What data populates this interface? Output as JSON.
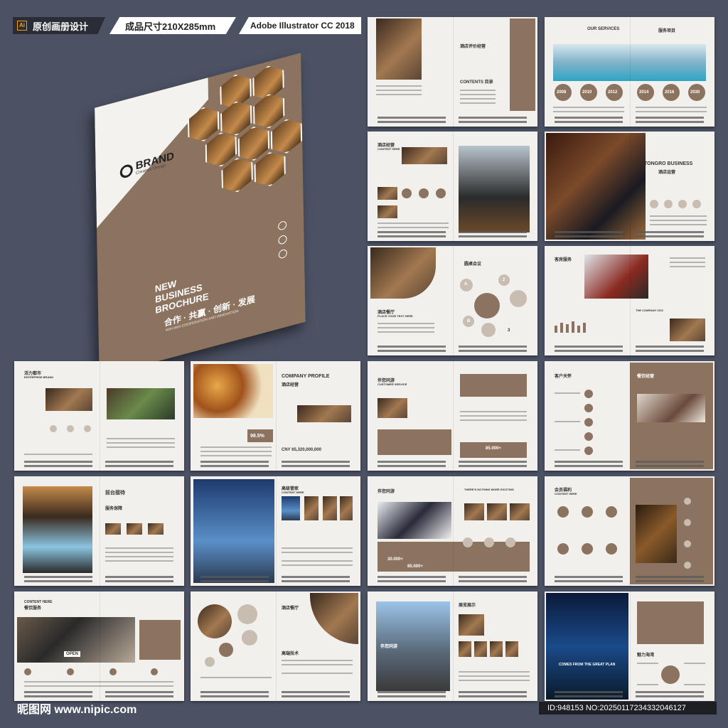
{
  "header": {
    "tag1": "原创画册设计",
    "tag2": "成品尺寸210X285mm",
    "tag3": "Adobe Illustrator CC 2018",
    "ai_icon": "Ai"
  },
  "cover": {
    "brand": "BRAND",
    "brand_sub": "Creative Design",
    "title_line1": "NEW",
    "title_line2": "BUSINESS",
    "title_line3": "BROCHURE",
    "slogan": "合作 · 共赢 · 创新 · 发展",
    "slogan_sub": "WIN-WIN COOPERATION AND INNOVATION"
  },
  "spreads": [
    {
      "t1": "酒店评价经营",
      "t2": "CONTENTS 目录"
    },
    {
      "t1": "OUR SERVICES",
      "t2": "服务项目",
      "years": [
        "2008",
        "2010",
        "2012",
        "2014",
        "2016",
        "2030"
      ]
    },
    {
      "t1": "酒店经营",
      "t2": "CONTENT HERE"
    },
    {
      "t1": "TONGRO BUSINESS",
      "t2": "酒店运营"
    },
    {
      "t1": "酒店餐厅",
      "t2": "圆桌会议",
      "t3": "PLACE YOUR TEXT HERE",
      "nodes": [
        "A",
        "2",
        "B",
        "3"
      ]
    },
    {
      "t1": "客房服务",
      "t2": "THE COMPANY CEO"
    },
    {
      "t1": "活力都市",
      "t2": "ENTERPRISE BRAND"
    },
    {
      "t1": "COMPANY PROFILE",
      "t2": "酒店经营",
      "pct": "98.5%",
      "money": "CNY 65,320,000,000"
    },
    {
      "t1": "伴您同游",
      "t2": "CUSTOMER SERVICE",
      "stat": "85.000+"
    },
    {
      "t1": "客户关怀",
      "t2": "餐饮经营"
    },
    {
      "t1": "前台接待",
      "t2": "服务保障"
    },
    {
      "t1": "高级管家",
      "t2": "CONTENT HERE"
    },
    {
      "t1": "伴您同游",
      "t2": "THERE'S NOTHING MORE EXCITING",
      "stat1": "30.000+",
      "stat2": "85.000+"
    },
    {
      "t1": "会员福利",
      "t2": "CONTENT HERE"
    },
    {
      "t1": "CONTENT HERE",
      "t2": "餐饮服务",
      "sign": "OPEN"
    },
    {
      "t1": "酒店餐厅",
      "t2": "高端技术"
    },
    {
      "t1": "展览展示",
      "t2": "伴您同游"
    },
    {
      "t1": "魅力海湾",
      "t2": "COMES FROM THE GREAT PLAN"
    }
  ],
  "footer": {
    "site": "昵图网 www.nipic.com",
    "id": "ID:948153 NO:20250117234332046127"
  }
}
